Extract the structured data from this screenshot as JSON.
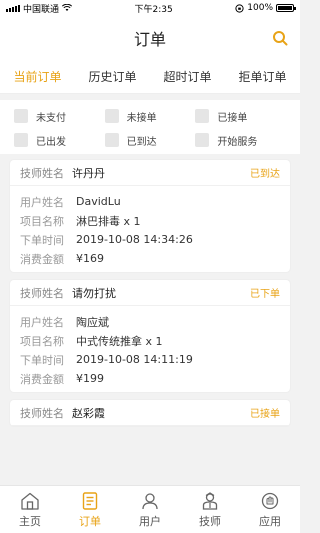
{
  "status_bar": {
    "carrier": "中国联通",
    "time": "下午2:35",
    "battery": "100%"
  },
  "header": {
    "title": "订单"
  },
  "tabs": [
    {
      "label": "当前订单",
      "active": true
    },
    {
      "label": "历史订单",
      "active": false
    },
    {
      "label": "超时订单",
      "active": false
    },
    {
      "label": "拒单订单",
      "active": false
    }
  ],
  "filters": [
    {
      "label": "未支付"
    },
    {
      "label": "未接单"
    },
    {
      "label": "已接单"
    },
    {
      "label": "已出发"
    },
    {
      "label": "已到达"
    },
    {
      "label": "开始服务"
    }
  ],
  "card_labels": {
    "tech": "技师姓名",
    "user": "用户姓名",
    "item": "项目名称",
    "time": "下单时间",
    "amount": "消费金额"
  },
  "orders": [
    {
      "tech": "许丹丹",
      "status": "已到达",
      "user": "DavidLu",
      "item": "淋巴排毒 x 1",
      "time": "2019-10-08 14:34:26",
      "amount": "¥169"
    },
    {
      "tech": "请勿打扰",
      "status": "已下单",
      "user": "陶应斌",
      "item": "中式传统推拿 x 1",
      "time": "2019-10-08 14:11:19",
      "amount": "¥199"
    },
    {
      "tech": "赵彩霞",
      "status": "已接单"
    }
  ],
  "bottom_nav": [
    {
      "label": "主页",
      "icon": "home-icon",
      "active": false
    },
    {
      "label": "订单",
      "icon": "order-icon",
      "active": true
    },
    {
      "label": "用户",
      "icon": "user-icon",
      "active": false
    },
    {
      "label": "技师",
      "icon": "technician-icon",
      "active": false
    },
    {
      "label": "应用",
      "icon": "apps-icon",
      "active": false
    }
  ],
  "colors": {
    "accent": "#e8a317",
    "background": "#f2f2f2"
  }
}
